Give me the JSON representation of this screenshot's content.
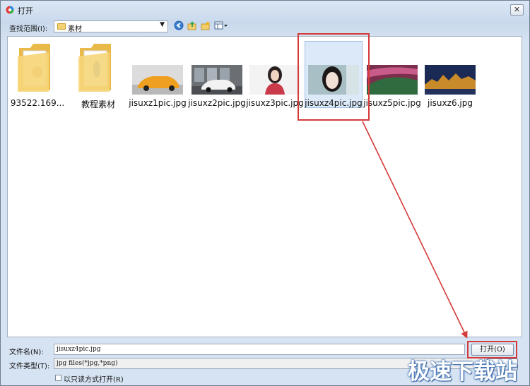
{
  "window": {
    "title": "打开",
    "close_glyph": "✕"
  },
  "lookin": {
    "label": "查找范围(I):",
    "value": "素材"
  },
  "toolbar": [
    "back-icon",
    "up-folder-icon",
    "new-folder-icon",
    "view-menu-icon"
  ],
  "files": [
    {
      "name": "93522.169...",
      "kind": "folder"
    },
    {
      "name": "教程素材",
      "kind": "folder"
    },
    {
      "name": "jisuxz1pic.jpg",
      "kind": "image"
    },
    {
      "name": "jisuxz2pic.jpg",
      "kind": "image"
    },
    {
      "name": "jisuxz3pic.jpg",
      "kind": "image"
    },
    {
      "name": "jisuxz4pic.jpg",
      "kind": "image",
      "selected": true
    },
    {
      "name": "jisuxz5pic.jpg",
      "kind": "image"
    },
    {
      "name": "jisuxz6.jpg",
      "kind": "image"
    }
  ],
  "filename": {
    "label": "文件名(N):",
    "value": "jisuxz4pic.jpg"
  },
  "filetype": {
    "label": "文件类型(T):",
    "value": "jpg files(*jpg,*png)"
  },
  "open_button": "打开(O)",
  "readonly": {
    "label": "以只读方式打开(R)",
    "checked": false
  },
  "watermark": "极速下载站",
  "colors": {
    "highlight": "#d43a3a",
    "selection": "#dbe9f9"
  }
}
